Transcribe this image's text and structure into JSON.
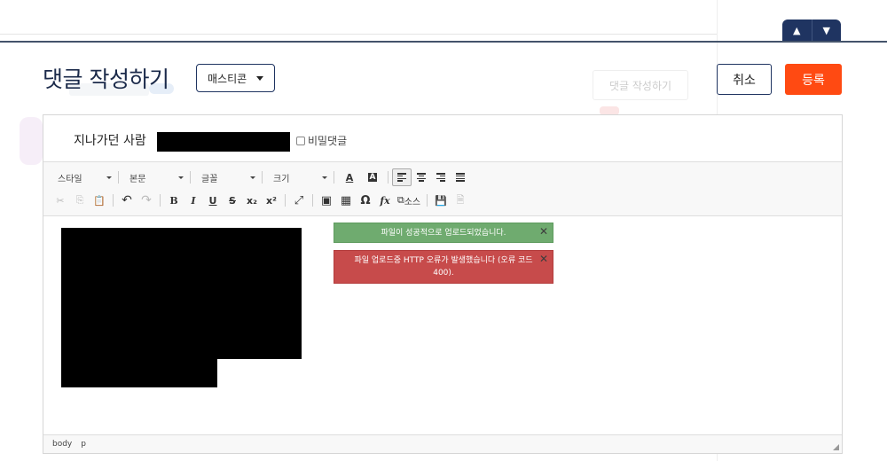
{
  "header": {
    "title": "댓글 작성하기",
    "emoticon_label": "매스티콘",
    "ghost_write_label": "댓글 작성하기",
    "cancel_label": "취소",
    "submit_label": "등록"
  },
  "scroll_nav": {
    "up": "▲",
    "down": "▼"
  },
  "author": {
    "name": "지나가던 사람",
    "secret_label": "비밀댓글"
  },
  "toolbar": {
    "combos": [
      "스타일",
      "본문",
      "글꼴",
      "크기"
    ],
    "source_label": "소스",
    "icons": {
      "cut": "✂",
      "copy": "⎘",
      "paste": "📋",
      "undo": "↶",
      "redo": "↷",
      "bold": "B",
      "italic": "I",
      "underline": "U",
      "strike": "S",
      "subscript": "x₂",
      "superscript": "x²",
      "maximize": "⤢",
      "image": "▣",
      "table": "▦",
      "special_char": "Ω",
      "formula": "fx",
      "source": "⧉",
      "save": "💾",
      "preview": "🗎",
      "text_color": "A",
      "bg_color": "A"
    }
  },
  "notifications": {
    "success": "파일이 성공적으로 업로드되었습니다.",
    "error": "파일 업로드중 HTTP 오류가 발생했습니다 (오류 코드 400).",
    "close": "✕"
  },
  "status_bar": {
    "path": [
      "body",
      "p"
    ]
  },
  "colors": {
    "accent": "#1f3461",
    "submit": "#ff4a12",
    "success": "#6fab6f",
    "error": "#c74b4b"
  }
}
